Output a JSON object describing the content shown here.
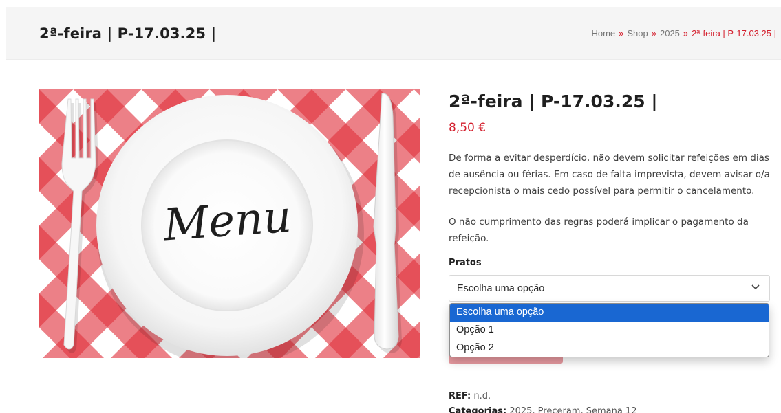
{
  "header": {
    "title": "2ª-feira | P-17.03.25 |",
    "breadcrumb": {
      "separator": "»",
      "items": [
        "Home",
        "Shop",
        "2025"
      ],
      "current": "2ª-feira | P-17.03.25 |"
    }
  },
  "product": {
    "image": {
      "text": "Menu"
    },
    "title": "2ª-feira | P-17.03.25 |",
    "price": "8,50 €",
    "description": [
      "De forma a evitar desperdício, não devem solicitar refeições em dias de ausência ou férias. Em caso de falta imprevista, devem avisar o/a recepcionista o mais cedo possível para permitir o cancelamento.",
      "O não cumprimento das regras poderá implicar o pagamento da refeição."
    ],
    "variation": {
      "label": "Pratos",
      "selected": "Escolha uma opção",
      "options": [
        "Escolha uma opção",
        "Opção 1",
        "Opção 2"
      ]
    },
    "meta": {
      "ref_label": "REF:",
      "ref_value": "n.d.",
      "categories_label": "Categorias:",
      "categories_value": "2025, Preceram, Semana 12"
    }
  },
  "colors": {
    "accent": "#d41f2d",
    "dropdown_highlight": "#1967d2",
    "header_bg": "#f5f5f5"
  },
  "icons": {
    "select_chevron": "chevron-down-icon",
    "plate": "menu-plate-image"
  }
}
